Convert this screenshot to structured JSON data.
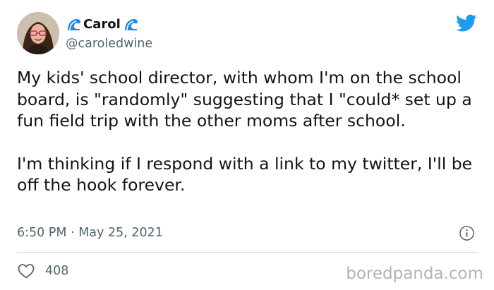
{
  "tweet": {
    "author": {
      "display_name": "Carol",
      "handle": "@caroledwine",
      "name_emoji": "wave-icon"
    },
    "paragraphs": [
      "My kids' school director, with whom I'm on the school board, is \"randomly\" suggesting that I \"could* set up a fun field trip with the other moms after school.",
      "I'm thinking if I respond with a link to my twitter, I'll be off the hook forever."
    ],
    "timestamp": "6:50 PM · May 25, 2021",
    "likes": "408"
  },
  "watermark": "boredpanda.com",
  "colors": {
    "twitter_blue": "#1d9bf0",
    "secondary_text": "#536471",
    "divider": "#cfd9de"
  }
}
